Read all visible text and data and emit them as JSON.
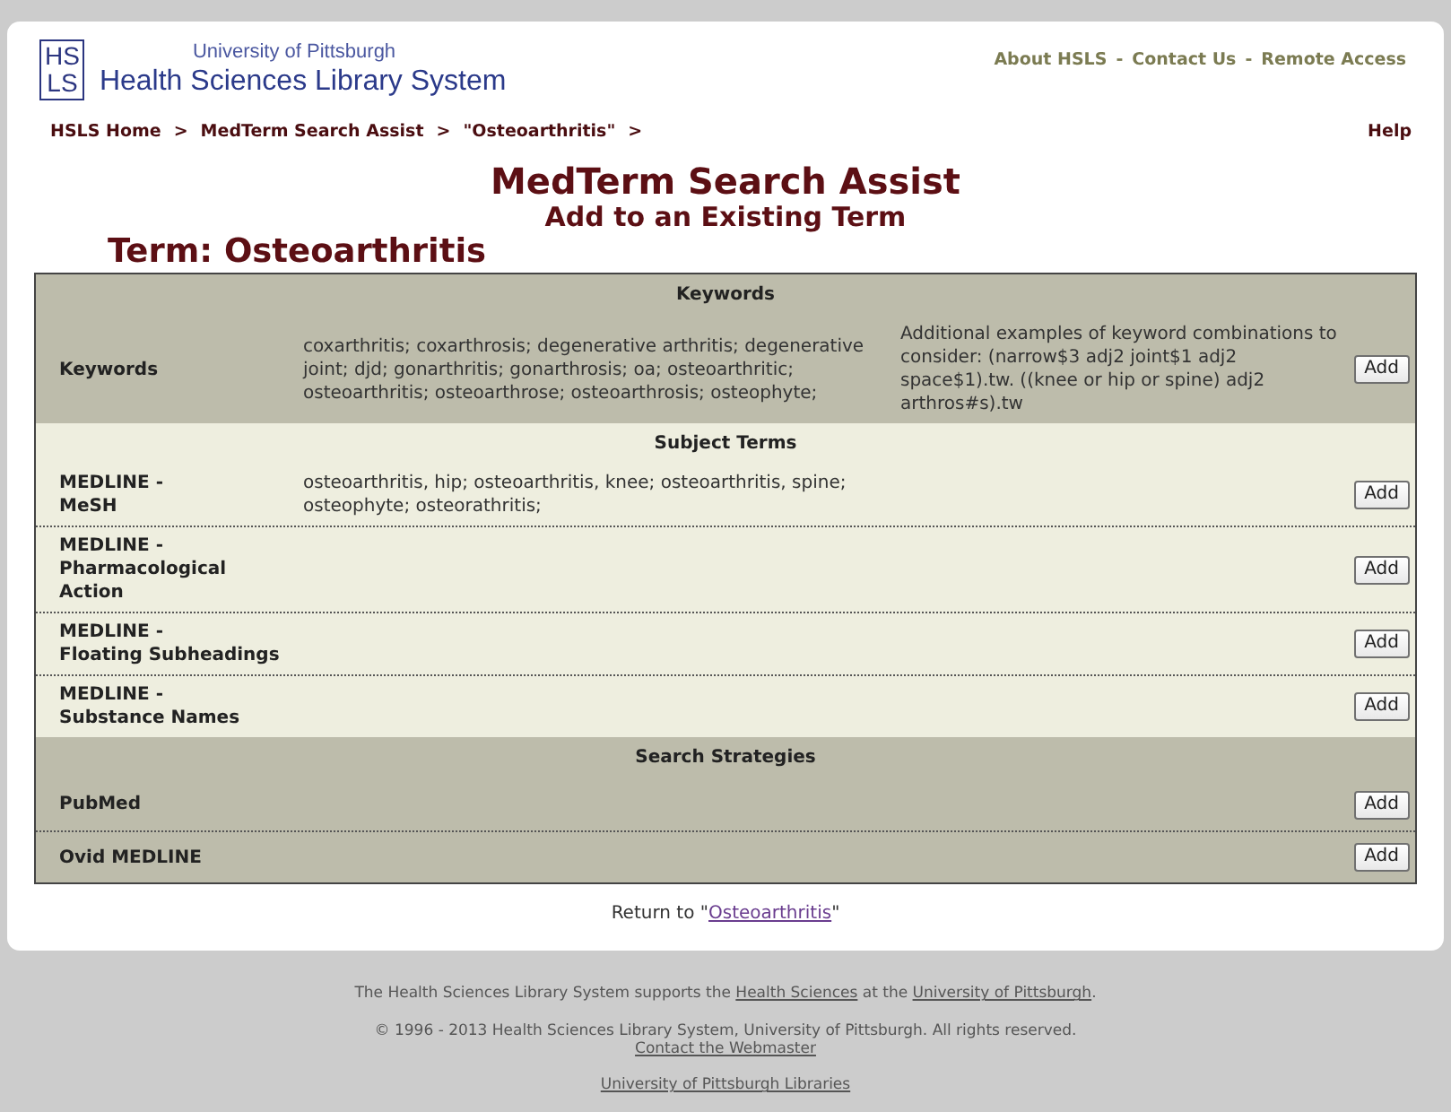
{
  "header": {
    "logo": {
      "mark_lines": [
        "HS",
        "LS"
      ],
      "university": "University of Pittsburgh",
      "name": "Health Sciences Library System"
    },
    "top_links": {
      "items": [
        "About HSLS",
        "Contact Us",
        "Remote Access"
      ],
      "separator": "-"
    }
  },
  "breadcrumb": {
    "items": [
      "HSLS Home",
      "MedTerm Search Assist",
      "\"Osteoarthritis\""
    ],
    "separator": ">",
    "help": "Help"
  },
  "title": "MedTerm Search Assist",
  "subtitle": "Add to an Existing Term",
  "term_heading": "Term: Osteoarthritis",
  "sections": [
    {
      "title": "Keywords",
      "color": "#bdbcab",
      "rows": [
        {
          "label_lines": [
            "Keywords"
          ],
          "content": "coxarthritis; coxarthrosis; degenerative arthritis; degenerative joint; djd; gonarthritis; gonarthrosis; oa; osteoarthritic; osteoarthritis; osteoarthrose; osteoarthrosis; osteophyte;",
          "note": "Additional examples of keyword combinations to consider: (narrow$3 adj2 joint$1 adj2 space$1).tw. ((knee or hip or spine) adj2 arthros#s).tw",
          "button": "Add"
        }
      ]
    },
    {
      "title": "Subject Terms",
      "color": "#eeeedf",
      "rows": [
        {
          "label_lines": [
            "MEDLINE -",
            "MeSH"
          ],
          "content": "osteoarthritis, hip; osteoarthritis, knee; osteoarthritis, spine; osteophyte; osteorathritis;",
          "button": "Add"
        },
        {
          "label_lines": [
            "MEDLINE -",
            "Pharmacological",
            "Action"
          ],
          "button": "Add"
        },
        {
          "label_lines": [
            "MEDLINE -",
            "Floating Subheadings"
          ],
          "button": "Add"
        },
        {
          "label_lines": [
            "MEDLINE -",
            "Substance Names"
          ],
          "button": "Add"
        }
      ]
    },
    {
      "title": "Search Strategies",
      "color": "#bdbcab",
      "rows": [
        {
          "label_lines": [
            "PubMed"
          ],
          "button": "Add"
        },
        {
          "label_lines": [
            "Ovid MEDLINE"
          ],
          "button": "Add"
        }
      ]
    }
  ],
  "return_line": [
    {
      "kind": "text",
      "text": "Return to \""
    },
    {
      "kind": "link",
      "text": "Osteoarthritis"
    },
    {
      "kind": "text",
      "text": "\""
    }
  ],
  "footer": {
    "support_line": [
      {
        "kind": "text",
        "text": "The Health Sciences Library System supports the "
      },
      {
        "kind": "link",
        "text": "Health Sciences"
      },
      {
        "kind": "text",
        "text": " at the "
      },
      {
        "kind": "link",
        "text": "University of Pittsburgh"
      },
      {
        "kind": "text",
        "text": "."
      }
    ],
    "copyright": "© 1996 - 2013 Health Sciences Library System, University of Pittsburgh. All rights reserved.",
    "webmaster_link": "Contact the Webmaster",
    "libraries_link": "University of Pittsburgh Libraries"
  }
}
